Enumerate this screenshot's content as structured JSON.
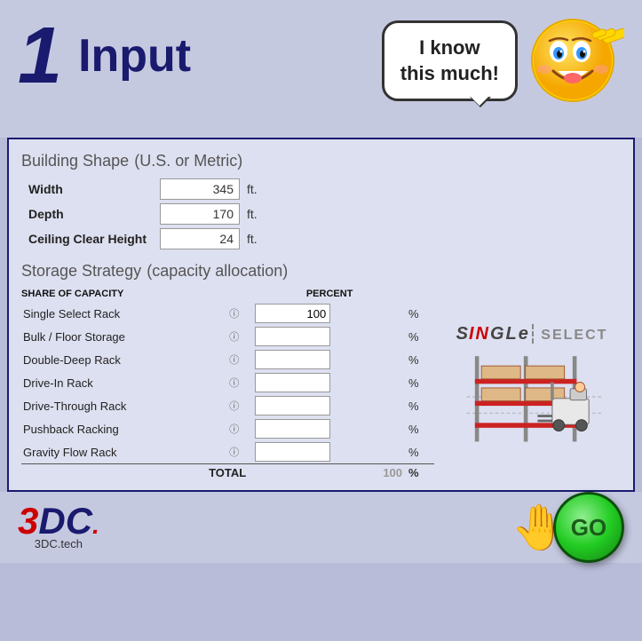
{
  "header": {
    "number": "1",
    "title": "Input",
    "speech_bubble": "I know\nthis much!"
  },
  "building_shape": {
    "section_title": "Building Shape",
    "section_subtitle": "(U.S. or Metric)",
    "fields": [
      {
        "label": "Width",
        "value": "345",
        "unit": "ft."
      },
      {
        "label": "Depth",
        "value": "170",
        "unit": "ft."
      },
      {
        "label": "Ceiling Clear Height",
        "value": "24",
        "unit": "ft."
      }
    ]
  },
  "storage_strategy": {
    "section_title": "Storage Strategy",
    "section_subtitle": "(capacity allocation)",
    "col_header_share": "SHARE OF CAPACITY",
    "col_header_percent": "PERCENT",
    "rows": [
      {
        "label": "Single Select Rack",
        "value": "100",
        "has_info": true
      },
      {
        "label": "Bulk / Floor Storage",
        "value": "",
        "has_info": true
      },
      {
        "label": "Double-Deep Rack",
        "value": "",
        "has_info": true
      },
      {
        "label": "Drive-In Rack",
        "value": "",
        "has_info": true
      },
      {
        "label": "Drive-Through Rack",
        "value": "",
        "has_info": true
      },
      {
        "label": "Pushback Racking",
        "value": "",
        "has_info": true
      },
      {
        "label": "Gravity Flow Rack",
        "value": "",
        "has_info": true
      }
    ],
    "total_label": "TOTAL",
    "total_value": "100"
  },
  "single_select": {
    "label_part1": "SIN",
    "label_part2": "GLE",
    "label_part3": " SELECT"
  },
  "footer": {
    "logo_main": "3DC",
    "logo_sub": ".",
    "logo_url": "3DC.tech",
    "go_label": "GO"
  }
}
